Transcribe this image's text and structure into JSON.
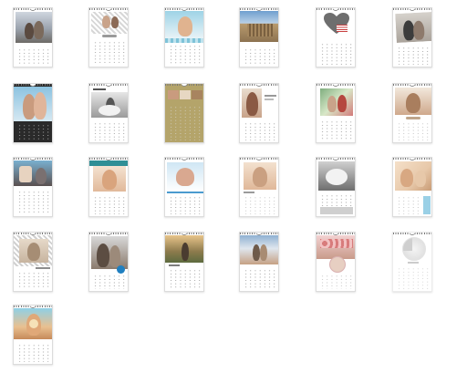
{
  "gallery": {
    "designs": [
      {
        "id": 1,
        "month_label": "",
        "photo": "#8a8f98",
        "accent": "#bfc3c9"
      },
      {
        "id": 2,
        "month_label": "",
        "photo": "#c9a38a",
        "accent": "#9d9d9d"
      },
      {
        "id": 3,
        "month_label": "",
        "photo": "#e0b38f",
        "accent": "#7fc3d8"
      },
      {
        "id": 4,
        "month_label": "",
        "photo": "#b89a6e",
        "accent": "#6f9fcf"
      },
      {
        "id": 5,
        "month_label": "",
        "photo": "#6e6e6e",
        "accent": "#c84040"
      },
      {
        "id": 6,
        "month_label": "",
        "photo": "#8d7a6c",
        "accent": "#444444"
      },
      {
        "id": 7,
        "month_label": "",
        "photo": "#c99b7e",
        "accent": "#2a2a2a"
      },
      {
        "id": 8,
        "month_label": "",
        "photo": "#9a9a9a",
        "accent": "#555555"
      },
      {
        "id": 9,
        "month_label": "",
        "photo": "#b9a77a",
        "accent": "#b4a46a"
      },
      {
        "id": 10,
        "month_label": "",
        "photo": "#c9a38a",
        "accent": "#e3d6c8"
      },
      {
        "id": 11,
        "month_label": "",
        "photo": "#d27a7a",
        "accent": "#7fae7f"
      },
      {
        "id": 12,
        "month_label": "",
        "photo": "#cfa98c",
        "accent": "#bfa58a"
      },
      {
        "id": 13,
        "month_label": "",
        "photo": "#7a7070",
        "accent": "#7ab0d0"
      },
      {
        "id": 14,
        "month_label": "",
        "photo": "#e1b99a",
        "accent": "#2f8f96"
      },
      {
        "id": 15,
        "month_label": "",
        "photo": "#d9a890",
        "accent": "#4b9bcf"
      },
      {
        "id": 16,
        "month_label": "",
        "photo": "#e0b899",
        "accent": "#9b9b9b"
      },
      {
        "id": 17,
        "month_label": "",
        "photo": "#8e8e8e",
        "accent": "#cfcfcf"
      },
      {
        "id": 18,
        "month_label": "",
        "photo": "#e7c8a9",
        "accent": "#9ad0e6"
      },
      {
        "id": 19,
        "month_label": "",
        "photo": "#c7b49f",
        "accent": "#8d8d8d"
      },
      {
        "id": 20,
        "month_label": "",
        "photo": "#8a7a6c",
        "accent": "#1f7fc0"
      },
      {
        "id": 21,
        "month_label": "",
        "photo": "#b79066",
        "accent": "#7f7f7f"
      },
      {
        "id": 22,
        "month_label": "",
        "photo": "#c6a184",
        "accent": "#6e8fb5"
      },
      {
        "id": 23,
        "month_label": "",
        "photo": "#c89a8a",
        "accent": "#d9b0b0"
      },
      {
        "id": 24,
        "month_label": "",
        "photo": "#e4e4e4",
        "accent": "#cccccc"
      },
      {
        "id": 25,
        "month_label": "",
        "photo": "#e9c090",
        "accent": "#c68a5a"
      }
    ]
  }
}
